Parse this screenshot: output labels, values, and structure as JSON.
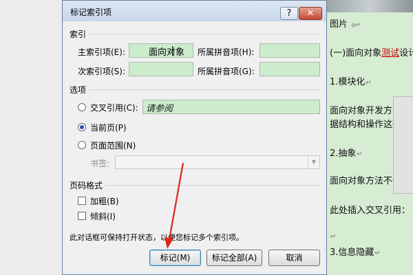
{
  "dialog": {
    "title": "标记索引项",
    "help_icon": "?",
    "close_icon": "✕",
    "index_section": "索引",
    "main_entry_label": "主索引项(E):",
    "main_entry_value": "面向对象",
    "main_pinyin_label": "所属拼音项(H):",
    "main_pinyin_value": "",
    "sub_entry_label": "次索引项(S):",
    "sub_entry_value": "",
    "sub_pinyin_label": "所属拼音项(G):",
    "sub_pinyin_value": "",
    "options_section": "选项",
    "cross_ref_label": "交叉引用(C):",
    "cross_ref_value": "请参阅",
    "current_page_label": "当前页(P)",
    "page_range_label": "页面范围(N)",
    "bookmark_label": "书签:",
    "bookmark_value": "",
    "page_format_section": "页码格式",
    "bold_label": "加粗(B)",
    "italic_label": "倾斜(I)",
    "note": "此对话框可保持打开状态，以便您标记多个索引项。",
    "mark_button": "标记(M)",
    "mark_all_button": "标记全部(A)",
    "cancel_button": "取消",
    "selected_option": "current_page",
    "bold_checked": false,
    "italic_checked": false
  },
  "document": {
    "line1": "图片",
    "line1_mark": "a↵",
    "line2_prefix": "(一)面向对象",
    "line2_red": "测试",
    "line2_suffix": "设计",
    "line3": "1.模块化",
    "line4": "面向对象开发方法很",
    "line5": "据结构和操作这些数",
    "line6": "2.抽象",
    "line7": "面向对象方法不仅支",
    "line8": "此处插入交叉引用：",
    "line9": "3.信息隐藏",
    "para_mark": "↵"
  },
  "colors": {
    "field_bg": "#cdeccd",
    "doc_bg": "#d6ecd3",
    "arrow": "#e0241c",
    "radio_dot": "#2a52a8"
  }
}
